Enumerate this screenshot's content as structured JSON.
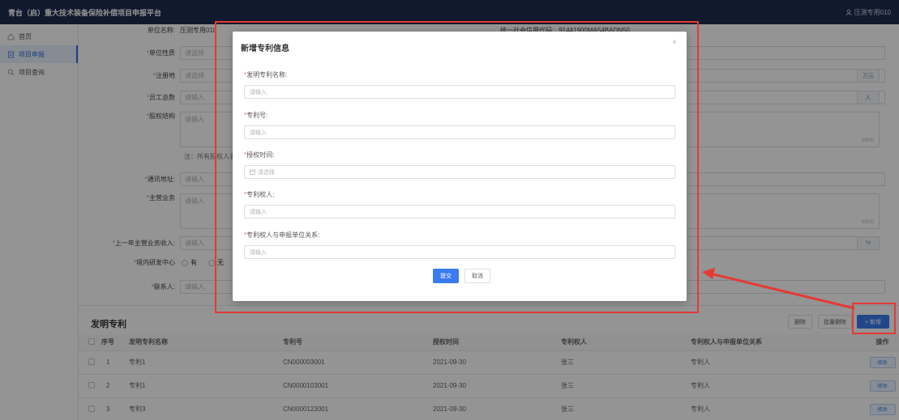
{
  "topbar": {
    "title": "青台（启）重大技术装备保险补偿项目申报平台",
    "user": "压测专用010"
  },
  "sidebar": {
    "items": [
      {
        "label": "首页",
        "icon": "home-icon"
      },
      {
        "label": "项目申报",
        "icon": "document-icon"
      },
      {
        "label": "项目查询",
        "icon": "search-icon"
      }
    ]
  },
  "form": {
    "unit_name": {
      "label": "单位名称:",
      "value": "压测专用010"
    },
    "credit_code": {
      "label": "统一社会信用代码:",
      "value": "91441900MA54BADN50"
    },
    "unit_nature": {
      "label": "单位性质",
      "placeholder": "请选择"
    },
    "reg_place": {
      "label": "注册地",
      "placeholder": "请选择",
      "unit": "万元"
    },
    "staff_count": {
      "label": "员工总数",
      "placeholder": "请输入",
      "unit": "人"
    },
    "equity": {
      "label": "股权结构",
      "placeholder": "请输入",
      "count": "0/500",
      "note": "注：所有股权人名称"
    },
    "address": {
      "label": "通讯地址:",
      "placeholder": "请输入"
    },
    "main_business": {
      "label": "主营业务",
      "placeholder": "请输入",
      "count": "0/500"
    },
    "revenue": {
      "label": "上一年主营业务收入:",
      "placeholder": "请输入",
      "unit": "%"
    },
    "rd_center": {
      "label": "境内研发中心",
      "yes": "有",
      "no": "无"
    },
    "contact": {
      "label": "联系人:",
      "placeholder": "请输入"
    }
  },
  "patents": {
    "title": "发明专利",
    "delete_label": "删除",
    "batch_delete_label": "批量删除",
    "add_label": "+ 新增",
    "columns": [
      "序号",
      "发明专利名称",
      "专利号",
      "授权时间",
      "专利权人",
      "专利权人与申报单位关系",
      "操作"
    ],
    "edit_label": "修改",
    "rows": [
      {
        "no": "1",
        "name": "专利1",
        "number": "CN000003001",
        "date": "2021-09-30",
        "holder": "张三",
        "relation": "专利人"
      },
      {
        "no": "2",
        "name": "专利1",
        "number": "CN0000103001",
        "date": "2021-09-30",
        "holder": "张三",
        "relation": "专利人"
      },
      {
        "no": "3",
        "name": "专利3",
        "number": "CN0000123001",
        "date": "2021-09-30",
        "holder": "张三",
        "relation": "专利人"
      }
    ]
  },
  "modal": {
    "title": "新增专利信息",
    "close": "×",
    "fields": [
      {
        "label": "发明专利名称:",
        "placeholder": "请输入"
      },
      {
        "label": "专利号:",
        "placeholder": "请输入"
      },
      {
        "label": "授权时间:",
        "placeholder": "请选择"
      },
      {
        "label": "专利权人:",
        "placeholder": "请输入"
      },
      {
        "label": "专利权人与申报单位关系:",
        "placeholder": "请输入"
      }
    ],
    "submit_label": "提交",
    "cancel_label": "取消"
  },
  "colors": {
    "primary": "#3a7bf0",
    "topbar": "#1d2b50",
    "annotation": "#e53935",
    "required": "#f56c6c"
  }
}
